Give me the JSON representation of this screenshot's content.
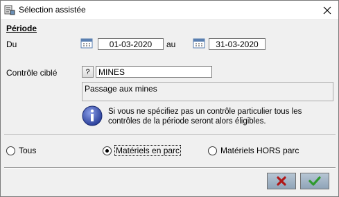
{
  "window": {
    "title": "Sélection assistée"
  },
  "periode": {
    "section_title": "Période",
    "from_label": "Du",
    "from_value": "01-03-2020",
    "to_label": "au",
    "to_value": "31-03-2020"
  },
  "controle": {
    "label": "Contrôle ciblé",
    "help_label": "?",
    "code_value": "MINES",
    "description": "Passage aux mines",
    "info_text": "Si vous ne spécifiez pas un contrôle particulier tous les contrôles de la période seront alors éligibles."
  },
  "filter": {
    "options": [
      {
        "label": "Tous",
        "checked": false
      },
      {
        "label": "Matériels en parc",
        "checked": true
      },
      {
        "label": "Matériels HORS parc",
        "checked": false
      }
    ]
  },
  "colors": {
    "cancel_icon": "#b01818",
    "ok_icon": "#2e9a2e"
  }
}
